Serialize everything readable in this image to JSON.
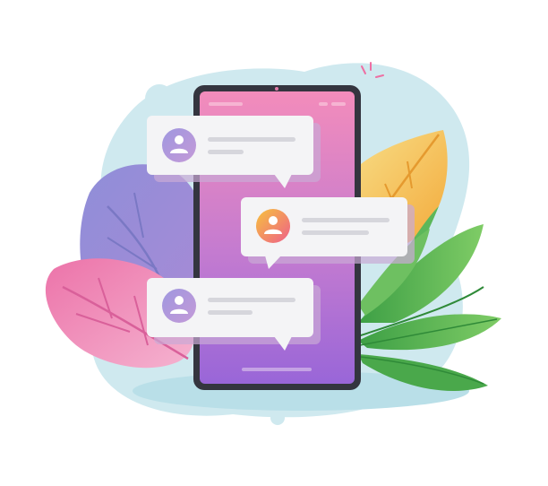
{
  "illustration": {
    "subject": "chat-notifications-on-smartphone",
    "icons": {
      "avatar": "user-avatar-icon",
      "sparkle": "sparkle-icon"
    },
    "colors": {
      "backdrop": "#cfe9ef",
      "phone_frame": "#34353f",
      "screen_top": "#f28ab8",
      "screen_bottom": "#9a68d6",
      "bubble": "#f4f4f6",
      "bubble_shadow": "#c9a9d6",
      "text_line": "#d6d6dc",
      "avatar_purple": "#a794d9",
      "avatar_orange": "#f4a23a",
      "leaf_purple": "#8a86d0",
      "leaf_pink": "#ee79ad",
      "leaf_yellow": "#f6c65a",
      "leaf_green": "#4fb04f"
    },
    "messages": [
      {
        "avatar_color": "purple",
        "text_lines": 2
      },
      {
        "avatar_color": "orange",
        "text_lines": 2
      },
      {
        "avatar_color": "purple",
        "text_lines": 2
      }
    ]
  }
}
